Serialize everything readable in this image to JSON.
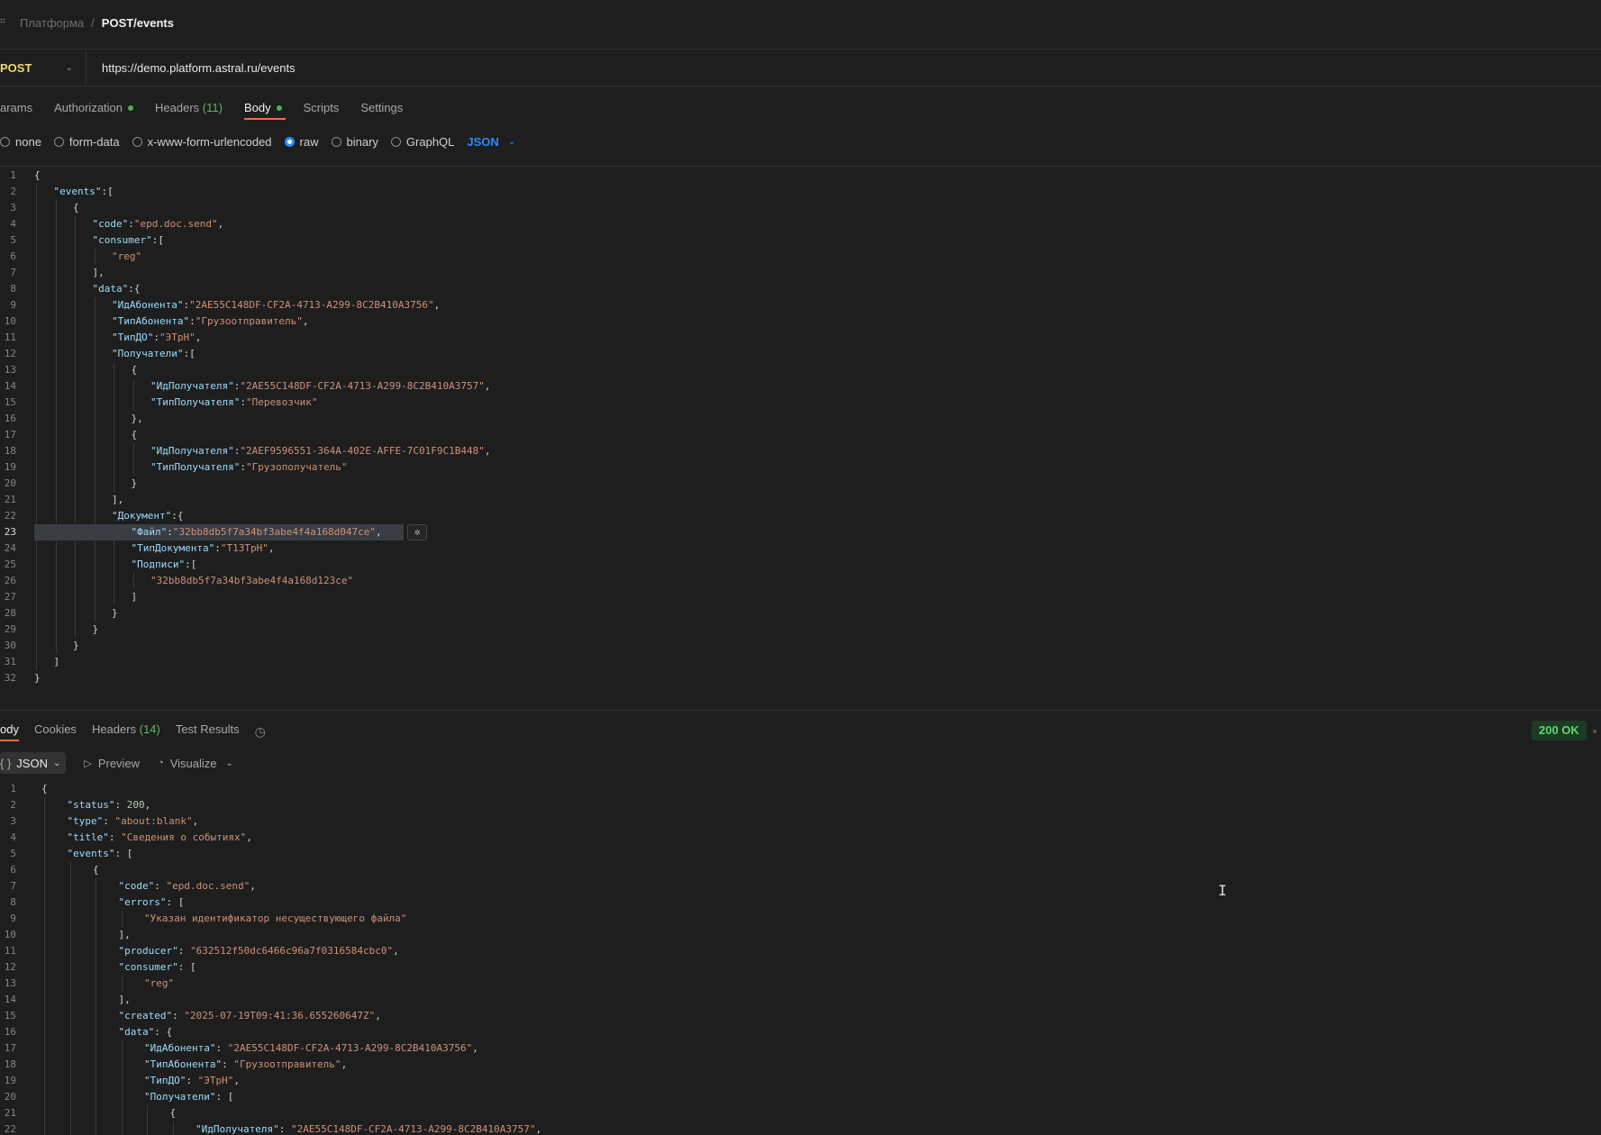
{
  "breadcrumb": {
    "parent": "Платформа",
    "separator": "/",
    "current": "POST/events"
  },
  "request": {
    "method": "POST",
    "url": "https://demo.platform.astral.ru/events",
    "tabs": [
      {
        "label": "arams",
        "count": "",
        "dot": false,
        "active": false
      },
      {
        "label": "Authorization",
        "count": "",
        "dot": true,
        "active": false
      },
      {
        "label": "Headers",
        "count": "(11)",
        "dot": false,
        "active": false
      },
      {
        "label": "Body",
        "count": "",
        "dot": true,
        "active": true
      },
      {
        "label": "Scripts",
        "count": "",
        "dot": false,
        "active": false
      },
      {
        "label": "Settings",
        "count": "",
        "dot": false,
        "active": false
      }
    ],
    "body_modes": [
      {
        "label": "none",
        "selected": false
      },
      {
        "label": "form-data",
        "selected": false
      },
      {
        "label": "x-www-form-urlencoded",
        "selected": false
      },
      {
        "label": "raw",
        "selected": true
      },
      {
        "label": "binary",
        "selected": false
      },
      {
        "label": "GraphQL",
        "selected": false
      }
    ],
    "format": "JSON",
    "body_lines": [
      {
        "n": "1",
        "indent": 0,
        "parts": [
          [
            "p",
            "{"
          ]
        ]
      },
      {
        "n": "2",
        "indent": 1,
        "parts": [
          [
            "k",
            "\"events\""
          ],
          [
            "p",
            ":["
          ]
        ]
      },
      {
        "n": "3",
        "indent": 2,
        "parts": [
          [
            "p",
            "{"
          ]
        ]
      },
      {
        "n": "4",
        "indent": 3,
        "parts": [
          [
            "k",
            "\"code\""
          ],
          [
            "p",
            ":"
          ],
          [
            "s",
            "\"epd.doc.send\""
          ],
          [
            "p",
            ","
          ]
        ]
      },
      {
        "n": "5",
        "indent": 3,
        "parts": [
          [
            "k",
            "\"consumer\""
          ],
          [
            "p",
            ":["
          ]
        ]
      },
      {
        "n": "6",
        "indent": 4,
        "parts": [
          [
            "s",
            "\"reg\""
          ]
        ]
      },
      {
        "n": "7",
        "indent": 3,
        "parts": [
          [
            "p",
            "],"
          ]
        ]
      },
      {
        "n": "8",
        "indent": 3,
        "parts": [
          [
            "k",
            "\"data\""
          ],
          [
            "p",
            ":{"
          ]
        ]
      },
      {
        "n": "9",
        "indent": 4,
        "parts": [
          [
            "k",
            "\"ИдАбонента\""
          ],
          [
            "p",
            ":"
          ],
          [
            "s",
            "\"2AE55C148DF-CF2A-4713-A299-8C2B410A3756\""
          ],
          [
            "p",
            ","
          ]
        ]
      },
      {
        "n": "10",
        "indent": 4,
        "parts": [
          [
            "k",
            "\"ТипАбонента\""
          ],
          [
            "p",
            ":"
          ],
          [
            "s",
            "\"Грузоотправитель\""
          ],
          [
            "p",
            ","
          ]
        ]
      },
      {
        "n": "11",
        "indent": 4,
        "parts": [
          [
            "k",
            "\"ТипДО\""
          ],
          [
            "p",
            ":"
          ],
          [
            "s",
            "\"ЭТрН\""
          ],
          [
            "p",
            ","
          ]
        ]
      },
      {
        "n": "12",
        "indent": 4,
        "parts": [
          [
            "k",
            "\"Получатели\""
          ],
          [
            "p",
            ":["
          ]
        ]
      },
      {
        "n": "13",
        "indent": 5,
        "parts": [
          [
            "p",
            "{"
          ]
        ]
      },
      {
        "n": "14",
        "indent": 6,
        "parts": [
          [
            "k",
            "\"ИдПолучателя\""
          ],
          [
            "p",
            ":"
          ],
          [
            "s",
            "\"2AE55C148DF-CF2A-4713-A299-8C2B410A3757\""
          ],
          [
            "p",
            ","
          ]
        ]
      },
      {
        "n": "15",
        "indent": 6,
        "parts": [
          [
            "k",
            "\"ТипПолучателя\""
          ],
          [
            "p",
            ":"
          ],
          [
            "s",
            "\"Перевозчик\""
          ]
        ]
      },
      {
        "n": "16",
        "indent": 5,
        "parts": [
          [
            "p",
            "},"
          ]
        ]
      },
      {
        "n": "17",
        "indent": 5,
        "parts": [
          [
            "p",
            "{"
          ]
        ]
      },
      {
        "n": "18",
        "indent": 6,
        "parts": [
          [
            "k",
            "\"ИдПолучателя\""
          ],
          [
            "p",
            ":"
          ],
          [
            "s",
            "\"2AEF9596551-364A-402E-AFFE-7C01F9C1B448\""
          ],
          [
            "p",
            ","
          ]
        ]
      },
      {
        "n": "19",
        "indent": 6,
        "parts": [
          [
            "k",
            "\"ТипПолучателя\""
          ],
          [
            "p",
            ":"
          ],
          [
            "s",
            "\"Грузополучатель\""
          ]
        ]
      },
      {
        "n": "20",
        "indent": 5,
        "parts": [
          [
            "p",
            "}"
          ]
        ]
      },
      {
        "n": "21",
        "indent": 4,
        "parts": [
          [
            "p",
            "],"
          ]
        ]
      },
      {
        "n": "22",
        "indent": 4,
        "parts": [
          [
            "k",
            "\"Документ\""
          ],
          [
            "p",
            ":{"
          ]
        ]
      },
      {
        "n": "23",
        "indent": 5,
        "parts": [
          [
            "k",
            "\"Файл\""
          ],
          [
            "p",
            ":"
          ],
          [
            "s",
            "\"32bb8db5f7a34bf3abe4f4a168d047ce\""
          ],
          [
            "p",
            ","
          ]
        ]
      },
      {
        "n": "24",
        "indent": 5,
        "parts": [
          [
            "k",
            "\"ТипДокумента\""
          ],
          [
            "p",
            ":"
          ],
          [
            "s",
            "\"Т13ТрН\""
          ],
          [
            "p",
            ","
          ]
        ]
      },
      {
        "n": "25",
        "indent": 5,
        "parts": [
          [
            "k",
            "\"Подписи\""
          ],
          [
            "p",
            ":["
          ]
        ]
      },
      {
        "n": "26",
        "indent": 6,
        "parts": [
          [
            "s",
            "\"32bb8db5f7a34bf3abe4f4a168d123ce\""
          ]
        ]
      },
      {
        "n": "27",
        "indent": 5,
        "parts": [
          [
            "p",
            "]"
          ]
        ]
      },
      {
        "n": "28",
        "indent": 4,
        "parts": [
          [
            "p",
            "}"
          ]
        ]
      },
      {
        "n": "29",
        "indent": 3,
        "parts": [
          [
            "p",
            "}"
          ]
        ]
      },
      {
        "n": "30",
        "indent": 2,
        "parts": [
          [
            "p",
            "}"
          ]
        ]
      },
      {
        "n": "31",
        "indent": 1,
        "parts": [
          [
            "p",
            "]"
          ]
        ]
      },
      {
        "n": "32",
        "indent": 0,
        "parts": [
          [
            "p",
            "}"
          ]
        ]
      }
    ]
  },
  "response": {
    "tabs": [
      {
        "label": "ody",
        "count": "",
        "active": true
      },
      {
        "label": "Cookies",
        "count": "",
        "active": false
      },
      {
        "label": "Headers",
        "count": "(14)",
        "active": false
      },
      {
        "label": "Test Results",
        "count": "",
        "active": false
      }
    ],
    "status": "200 OK",
    "format": "JSON",
    "preview_label": "Preview",
    "visualize_label": "Visualize",
    "body_lines": [
      {
        "n": "1",
        "indent": 0,
        "parts": [
          [
            "p",
            "{"
          ]
        ]
      },
      {
        "n": "2",
        "indent": 1,
        "parts": [
          [
            "k",
            "\"status\""
          ],
          [
            "p",
            ": "
          ],
          [
            "n",
            "200"
          ],
          [
            "p",
            ","
          ]
        ]
      },
      {
        "n": "3",
        "indent": 1,
        "parts": [
          [
            "k",
            "\"type\""
          ],
          [
            "p",
            ": "
          ],
          [
            "s",
            "\"about:blank\""
          ],
          [
            "p",
            ","
          ]
        ]
      },
      {
        "n": "4",
        "indent": 1,
        "parts": [
          [
            "k",
            "\"title\""
          ],
          [
            "p",
            ": "
          ],
          [
            "s",
            "\"Сведения о событиях\""
          ],
          [
            "p",
            ","
          ]
        ]
      },
      {
        "n": "5",
        "indent": 1,
        "parts": [
          [
            "k",
            "\"events\""
          ],
          [
            "p",
            ": ["
          ]
        ]
      },
      {
        "n": "6",
        "indent": 2,
        "parts": [
          [
            "p",
            "{"
          ]
        ]
      },
      {
        "n": "7",
        "indent": 3,
        "parts": [
          [
            "k",
            "\"code\""
          ],
          [
            "p",
            ": "
          ],
          [
            "s",
            "\"epd.doc.send\""
          ],
          [
            "p",
            ","
          ]
        ]
      },
      {
        "n": "8",
        "indent": 3,
        "parts": [
          [
            "k",
            "\"errors\""
          ],
          [
            "p",
            ": ["
          ]
        ]
      },
      {
        "n": "9",
        "indent": 4,
        "parts": [
          [
            "s",
            "\"Указан идентификатор несуществующего файла\""
          ]
        ]
      },
      {
        "n": "10",
        "indent": 3,
        "parts": [
          [
            "p",
            "],"
          ]
        ]
      },
      {
        "n": "11",
        "indent": 3,
        "parts": [
          [
            "k",
            "\"producer\""
          ],
          [
            "p",
            ": "
          ],
          [
            "s",
            "\"632512f50dc6466c96a7f0316584cbc0\""
          ],
          [
            "p",
            ","
          ]
        ]
      },
      {
        "n": "12",
        "indent": 3,
        "parts": [
          [
            "k",
            "\"consumer\""
          ],
          [
            "p",
            ": ["
          ]
        ]
      },
      {
        "n": "13",
        "indent": 4,
        "parts": [
          [
            "s",
            "\"reg\""
          ]
        ]
      },
      {
        "n": "14",
        "indent": 3,
        "parts": [
          [
            "p",
            "],"
          ]
        ]
      },
      {
        "n": "15",
        "indent": 3,
        "parts": [
          [
            "k",
            "\"created\""
          ],
          [
            "p",
            ": "
          ],
          [
            "s",
            "\"2025-07-19T09:41:36.655260647Z\""
          ],
          [
            "p",
            ","
          ]
        ]
      },
      {
        "n": "16",
        "indent": 3,
        "parts": [
          [
            "k",
            "\"data\""
          ],
          [
            "p",
            ": {"
          ]
        ]
      },
      {
        "n": "17",
        "indent": 4,
        "parts": [
          [
            "k",
            "\"ИдАбонента\""
          ],
          [
            "p",
            ": "
          ],
          [
            "s",
            "\"2AE55C148DF-CF2A-4713-A299-8C2B410A3756\""
          ],
          [
            "p",
            ","
          ]
        ]
      },
      {
        "n": "18",
        "indent": 4,
        "parts": [
          [
            "k",
            "\"ТипАбонента\""
          ],
          [
            "p",
            ": "
          ],
          [
            "s",
            "\"Грузоотправитель\""
          ],
          [
            "p",
            ","
          ]
        ]
      },
      {
        "n": "19",
        "indent": 4,
        "parts": [
          [
            "k",
            "\"ТипДО\""
          ],
          [
            "p",
            ": "
          ],
          [
            "s",
            "\"ЭТрН\""
          ],
          [
            "p",
            ","
          ]
        ]
      },
      {
        "n": "20",
        "indent": 4,
        "parts": [
          [
            "k",
            "\"Получатели\""
          ],
          [
            "p",
            ": ["
          ]
        ]
      },
      {
        "n": "21",
        "indent": 5,
        "parts": [
          [
            "p",
            "{"
          ]
        ]
      },
      {
        "n": "22",
        "indent": 6,
        "parts": [
          [
            "k",
            "\"ИдПолучателя\""
          ],
          [
            "p",
            ": "
          ],
          [
            "s",
            "\"2AE55C148DF-CF2A-4713-A299-8C2B410A3757\""
          ],
          [
            "p",
            ","
          ]
        ]
      }
    ]
  },
  "icons": {
    "history": "history-icon",
    "inlay": "ai-assist-icon",
    "cursor": "text-cursor-icon"
  }
}
